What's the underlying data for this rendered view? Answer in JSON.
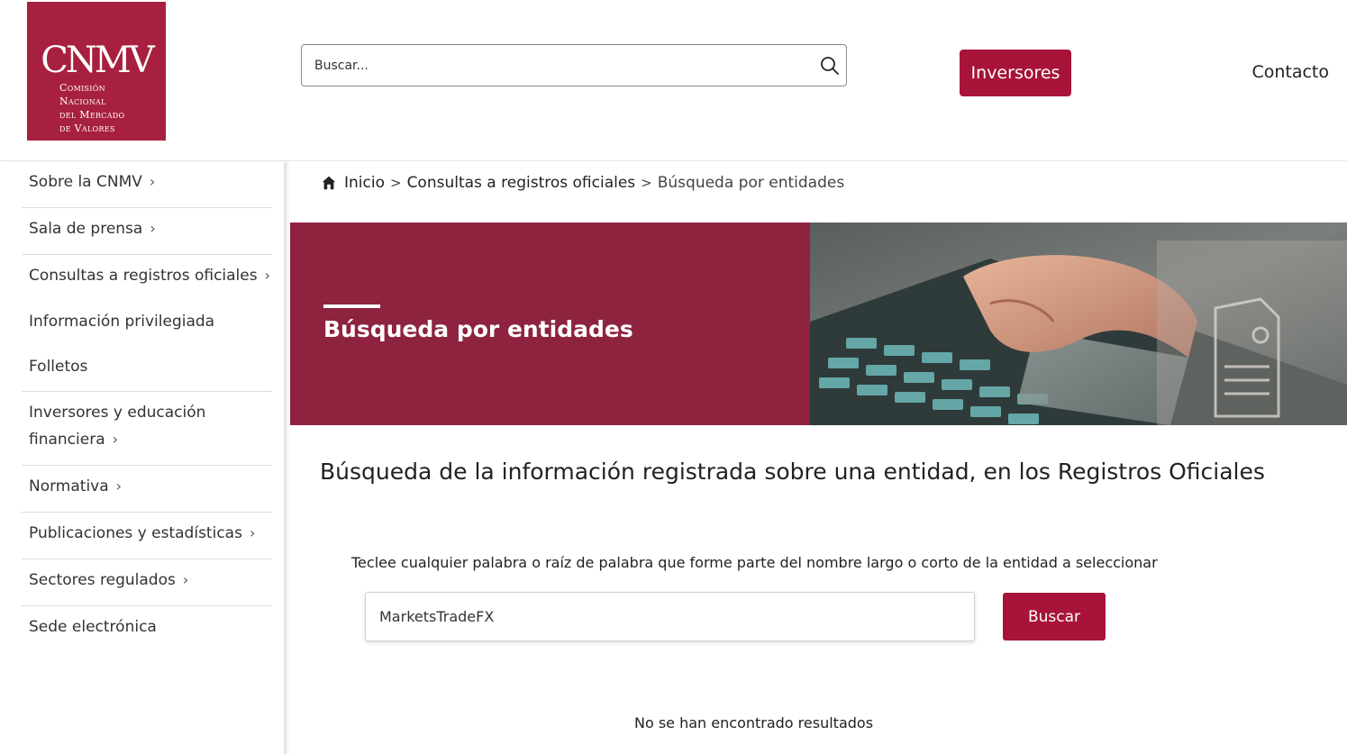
{
  "header": {
    "logo": {
      "abbr": "CNMV",
      "line1": "Comisión",
      "line2": "Nacional",
      "line3": "del Mercado",
      "line4": "de Valores"
    },
    "search_placeholder": "Buscar...",
    "inversores_label": "Inversores",
    "contacto_label": "Contacto"
  },
  "sidebar": {
    "items": [
      {
        "label": "Sobre la CNMV",
        "chevron": "›"
      },
      {
        "label": "Sala de prensa",
        "chevron": "›"
      },
      {
        "label": "Consultas a registros oficiales",
        "chevron": "›"
      },
      {
        "label": "Información privilegiada"
      },
      {
        "label": "Folletos"
      },
      {
        "label_line1": "Inversores y educación",
        "label_line2": "financiera",
        "chevron": "›"
      },
      {
        "label": "Normativa",
        "chevron": "›"
      },
      {
        "label": "Publicaciones y estadísticas",
        "chevron": "›"
      },
      {
        "label": "Sectores regulados",
        "chevron": "›"
      },
      {
        "label": "Sede electrónica"
      }
    ]
  },
  "breadcrumb": {
    "home": "Inicio",
    "sep": ">",
    "level1": "Consultas a registros oficiales",
    "current": "Búsqueda por entidades"
  },
  "hero": {
    "title": "Búsqueda por entidades"
  },
  "main": {
    "title": "Búsqueda de la información registrada sobre una entidad, en los Registros Oficiales",
    "instruction": "Teclee cualquier palabra o raíz de palabra que forme parte del nombre largo o corto de la entidad a seleccionar",
    "entity_value": "MarketsTradeFX",
    "buscar_label": "Buscar",
    "no_results": "No se han encontrado resultados"
  },
  "colors": {
    "brand": "#a8133a",
    "hero_bg": "#8e2340"
  }
}
